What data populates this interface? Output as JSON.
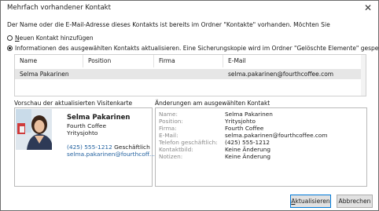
{
  "window": {
    "title": "Mehrfach vorhandener Kontakt",
    "close_glyph": "✕"
  },
  "intro": "Der Name oder die E-Mail-Adresse dieses Kontakts ist bereits im Ordner \"Kontakte\" vorhanden. Möchten Sie",
  "options": {
    "new": {
      "underline": "N",
      "rest": "euen Kontakt hinzufügen",
      "checked": false
    },
    "update": {
      "label": "Informationen des ausgewählten Kontakts aktualisieren. Eine Sicherungskopie wird im Ordner \"Gelöschte Elemente\" gespeichert.",
      "checked": true
    }
  },
  "table": {
    "headers": [
      "Name",
      "Position",
      "Firma",
      "E-Mail"
    ],
    "rows": [
      [
        "Selma Pakarinen",
        "",
        "",
        "selma.pakarinen@fourthcoffee.com"
      ]
    ]
  },
  "preview": {
    "label": "Vorschau der aktualisierten Visitenkarte",
    "name": "Selma Pakarinen",
    "company": "Fourth Coffee",
    "title": "Yritysjohto",
    "phone": "(425) 555-1212",
    "phone_type": "Geschäftlich",
    "email": "selma.pakarinen@fourthcoff..."
  },
  "changes": {
    "label": "Änderungen am ausgewählten Kontakt",
    "rows": [
      {
        "key": "Name:",
        "value": "Selma Pakarinen"
      },
      {
        "key": "Position:",
        "value": "Yritysjohto"
      },
      {
        "key": "Firma:",
        "value": "Fourth Coffee"
      },
      {
        "key": "E-Mail:",
        "value": "selma.pakarinen@fourthcoffee.com"
      },
      {
        "key": "Telefon geschäftlich:",
        "value": "(425) 555-1212"
      },
      {
        "key": "Kontaktbild:",
        "value": "Keine Änderung"
      },
      {
        "key": "Notizen:",
        "value": "Keine Änderung"
      }
    ]
  },
  "buttons": {
    "update": {
      "underline": "A",
      "rest": "ktualisieren"
    },
    "cancel": "Abbrechen"
  }
}
